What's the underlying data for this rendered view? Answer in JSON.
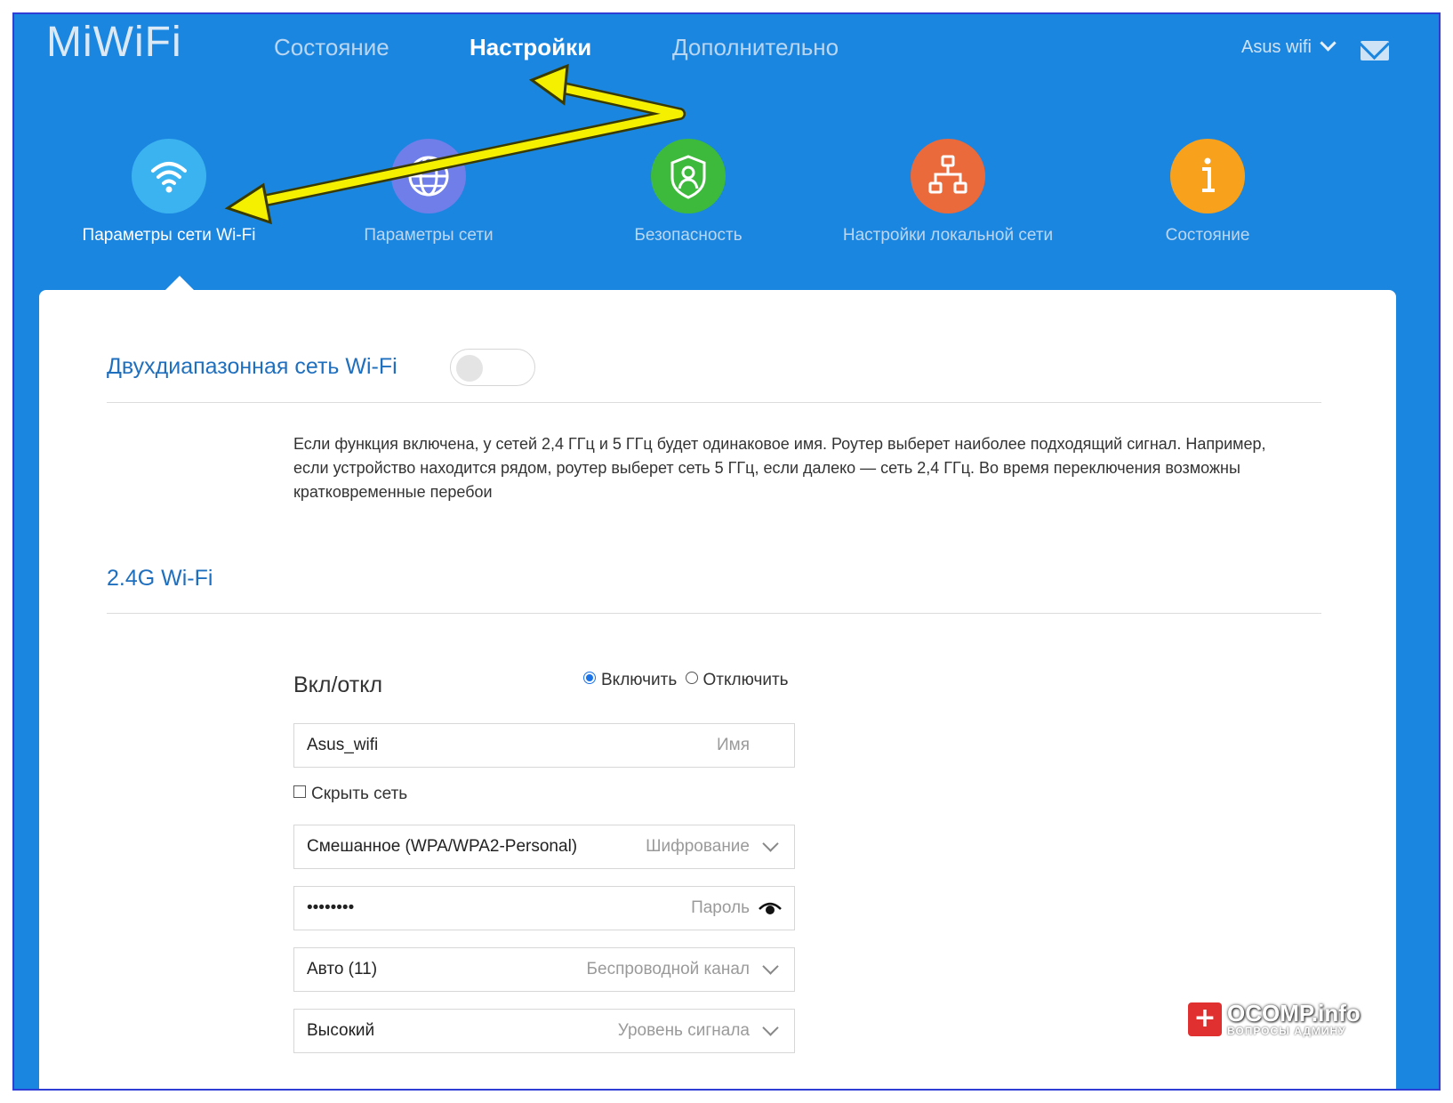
{
  "header": {
    "logo": "MiWiFi",
    "nav": [
      {
        "label": "Состояние",
        "active": false
      },
      {
        "label": "Настройки",
        "active": true
      },
      {
        "label": "Дополнительно",
        "active": false
      }
    ],
    "user_label": "Asus wifi"
  },
  "categories": [
    {
      "label": "Параметры сети Wi-Fi",
      "color": "#3bb3f0",
      "icon": "wifi-icon",
      "active": true
    },
    {
      "label": "Параметры сети",
      "color": "#6f7ee8",
      "icon": "globe-icon",
      "active": false
    },
    {
      "label": "Безопасность",
      "color": "#3db93c",
      "icon": "shield-icon",
      "active": false
    },
    {
      "label": "Настройки локальной сети",
      "color": "#ea6a3b",
      "icon": "network-icon",
      "active": false
    },
    {
      "label": "Состояние",
      "color": "#f7a11d",
      "icon": "info-icon",
      "active": false
    }
  ],
  "dual_band": {
    "title": "Двухдиапазонная сеть Wi-Fi",
    "enabled": false,
    "description": "Если функция включена, у сетей 2,4 ГГц и 5 ГГц будет одинаковое имя. Роутер выберет наиболее подходящий сигнал. Например, если устройство находится рядом, роутер выберет сеть 5 ГГц, если далеко — сеть 2,4 ГГц. Во время переключения возможны кратковременные перебои"
  },
  "wifi24": {
    "title": "2.4G Wi-Fi",
    "onoff_label": "Вкл/откл",
    "on_label": "Включить",
    "off_label": "Отключить",
    "name_value": "Asus_wifi",
    "name_placeholder": "Имя",
    "hide_label": "Скрыть сеть",
    "encryption_value": "Смешанное (WPA/WPA2-Personal)",
    "encryption_placeholder": "Шифрование",
    "password_value": "••••••••",
    "password_placeholder": "Пароль",
    "channel_value": "Авто (11)",
    "channel_placeholder": "Беспроводной канал",
    "signal_value": "Высокий",
    "signal_placeholder": "Уровень сигнала"
  },
  "watermark": {
    "plus": "+",
    "brand": "OCOMP.info",
    "tagline": "ВОПРОСЫ АДМИНУ"
  },
  "colors": {
    "header_bg": "#1b86e0",
    "accent_title": "#1f6fbf",
    "arrow": "#f5f000"
  }
}
